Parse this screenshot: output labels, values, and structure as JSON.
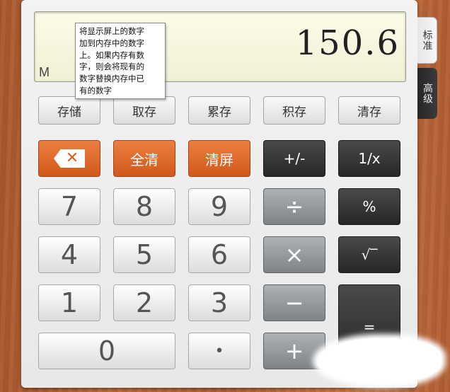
{
  "display": {
    "value": "150.6",
    "memory_indicator": "M"
  },
  "tooltip": {
    "lines": [
      "将显示屏上的数字",
      "加到内存中的数字",
      "上。如果内存有数",
      "字，则会将现有的",
      "数字替换内存中已",
      "有的数字"
    ]
  },
  "tabs": {
    "standard": "标准",
    "advanced": "高级"
  },
  "memory_buttons": {
    "store": "存储",
    "recall": "取存",
    "add": "累存",
    "multiply": "积存",
    "clear": "清存"
  },
  "function_buttons": {
    "clear_all": "全清",
    "clear_screen": "清屏",
    "negate": "+/-",
    "reciprocal": "1/x",
    "percent": "%",
    "sqrt": "√‾"
  },
  "digits": {
    "d0": "0",
    "d1": "1",
    "d2": "2",
    "d3": "3",
    "d4": "4",
    "d5": "5",
    "d6": "6",
    "d7": "7",
    "d8": "8",
    "d9": "9",
    "dot": "•"
  },
  "operators": {
    "divide": "÷",
    "multiply": "×",
    "subtract": "−",
    "add": "+",
    "equals": "="
  },
  "icons": {
    "backspace": "backspace-icon",
    "sqrt": "sqrt-icon"
  },
  "colors": {
    "accent_orange": "#d9601f",
    "dark_key": "#2e2e2e",
    "operator_key": "#8f9395",
    "display_bg": "#f6f6df"
  }
}
